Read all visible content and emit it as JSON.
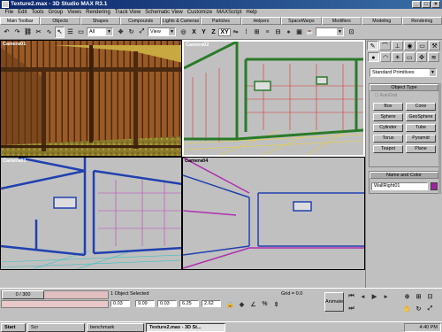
{
  "window": {
    "title": "Texture2.max - 3D Studio MAX R3.1",
    "min": "_",
    "max": "□",
    "close": "×"
  },
  "menu": [
    "File",
    "Edit",
    "Tools",
    "Group",
    "Views",
    "Rendering",
    "Track View",
    "Schematic View",
    "Customize",
    "MAXScript",
    "Help"
  ],
  "tabs": [
    {
      "label": "Main Toolbar",
      "active": true
    },
    {
      "label": "Objects"
    },
    {
      "label": "Shapes"
    },
    {
      "label": "Compounds"
    },
    {
      "label": "Lights & Cameras"
    },
    {
      "label": "Particles"
    },
    {
      "label": "Helpers"
    },
    {
      "label": "SpaceWarps"
    },
    {
      "label": "Modifiers"
    },
    {
      "label": "Modeling"
    },
    {
      "label": "Rendering"
    }
  ],
  "toolbar": {
    "selection_filter": "All",
    "ref_coord": "View",
    "axes": [
      "X",
      "Y",
      "Z",
      "XY"
    ]
  },
  "viewports": [
    {
      "label": "Camera01"
    },
    {
      "label": "Camera02"
    },
    {
      "label": "Camera03"
    },
    {
      "label": "Camera04"
    }
  ],
  "command_panel": {
    "category": "Standard Primitives",
    "object_type_title": "Object Type",
    "autogrid": "AutoGrid",
    "buttons": [
      "Box",
      "Cone",
      "Sphere",
      "GeoSphere",
      "Cylinder",
      "Tube",
      "Torus",
      "Pyramid",
      "Teapot",
      "Plane"
    ],
    "name_color_title": "Name and Color",
    "object_name": "WallRight01",
    "object_color": "#a020a0"
  },
  "status": {
    "time": "0 / 300",
    "selected": "1 Object Selected",
    "grid": "Grid = 0.0",
    "coords": [
      "0.03",
      "9.09",
      "0.03",
      "6.25",
      "2.62"
    ],
    "animate": "Animate"
  },
  "taskbar": {
    "start": "Start",
    "items": [
      {
        "label": "Scr"
      },
      {
        "label": "benchmark"
      },
      {
        "label": "Texture2.max - 3D St...",
        "active": true
      }
    ],
    "clock": "4:40 PM"
  }
}
